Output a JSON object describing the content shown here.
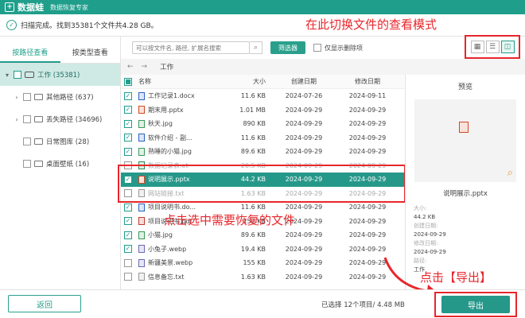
{
  "titlebar": {
    "app_name": "数据蛙",
    "subtitle": "数据恢复专家"
  },
  "status": {
    "text": "扫描完成。找到35381个文件共4.28 GB。"
  },
  "annotations": {
    "view_hint": "在此切换文件的查看模式",
    "select_hint": "点击选中需要恢复的文件",
    "export_hint": "点击【导出】"
  },
  "left_tabs": [
    {
      "label": "按路径查看"
    },
    {
      "label": "按类型查看"
    }
  ],
  "tree": [
    {
      "label": "工作 (35381)"
    },
    {
      "label": "其他路径 (637)"
    },
    {
      "label": "丢失路径 (34696)"
    },
    {
      "label": "日常图库 (28)"
    },
    {
      "label": "桌面壁纸 (16)"
    }
  ],
  "search": {
    "placeholder": "可以按文件名, 路径, 扩展名搜索"
  },
  "toolbar": {
    "filter_label": "筛选器",
    "deleted_only_label": "仅显示删除项"
  },
  "breadcrumb": {
    "current": "工作"
  },
  "table": {
    "headers": {
      "name": "名称",
      "size": "大小",
      "created": "创建日期",
      "modified": "修改日期"
    },
    "rows": [
      {
        "name": "工作记录1.docx",
        "size": "11.6 KB",
        "created": "2024-07-26",
        "modified": "2024-09-11",
        "icon": "docx-icon"
      },
      {
        "name": "期末用.pptx",
        "size": "1.01 MB",
        "created": "2024-09-29",
        "modified": "2024-09-29",
        "icon": "pptx-icon"
      },
      {
        "name": "秋天.jpg",
        "size": "890 KB",
        "created": "2024-09-29",
        "modified": "2024-09-29",
        "icon": "jpg-icon"
      },
      {
        "name": "软件介绍 - 副...",
        "size": "11.6 KB",
        "created": "2024-09-29",
        "modified": "2024-09-29",
        "icon": "docx-icon"
      },
      {
        "name": "熟睡的小猫.jpg",
        "size": "89.6 KB",
        "created": "2024-09-29",
        "modified": "2024-09-29",
        "icon": "jpg-icon"
      },
      {
        "name": "数据记录表.et",
        "size": "20.5 KB",
        "created": "2024-09-29",
        "modified": "2024-09-29",
        "icon": "et-icon"
      },
      {
        "name": "说明展示.pptx",
        "size": "44.2 KB",
        "created": "2024-09-29",
        "modified": "2024-09-29",
        "icon": "pptx-icon"
      },
      {
        "name": "网站链接.txt",
        "size": "1.63 KB",
        "created": "2024-09-29",
        "modified": "2024-09-29",
        "icon": "txt-icon"
      },
      {
        "name": "项目说明书.do...",
        "size": "11.6 KB",
        "created": "2024-09-29",
        "modified": "2024-09-29",
        "icon": "docx-icon"
      },
      {
        "name": "项目说明书.pdf",
        "size": "152 KB",
        "created": "2024-09-29",
        "modified": "2024-09-29",
        "icon": "pdf-icon"
      },
      {
        "name": "小猫.jpg",
        "size": "89.6 KB",
        "created": "2024-09-29",
        "modified": "2024-09-29",
        "icon": "jpg-icon"
      },
      {
        "name": "小兔子.webp",
        "size": "19.4 KB",
        "created": "2024-09-29",
        "modified": "2024-09-29",
        "icon": "webp-icon"
      },
      {
        "name": "新疆美景.webp",
        "size": "155 KB",
        "created": "2024-09-29",
        "modified": "2024-09-29",
        "icon": "webp-icon"
      },
      {
        "name": "信息备忘.txt",
        "size": "1.63 KB",
        "created": "2024-09-29",
        "modified": "2024-09-29",
        "icon": "txt-icon"
      }
    ]
  },
  "preview": {
    "title": "预览",
    "filename": "说明展示.pptx",
    "labels": {
      "size": "大小:",
      "created": "创建日期:",
      "modified": "修改日期:",
      "path": "路径:"
    },
    "values": {
      "size": "44.2 KB",
      "created": "2024-09-29",
      "modified": "2024-09-29",
      "path": "工作"
    }
  },
  "bottom": {
    "back_label": "返回",
    "selection": "已选择 12个项目/ 4.48 MB",
    "export_label": "导出"
  },
  "colors": {
    "accent": "#26988a",
    "annotation": "#e8262b"
  }
}
